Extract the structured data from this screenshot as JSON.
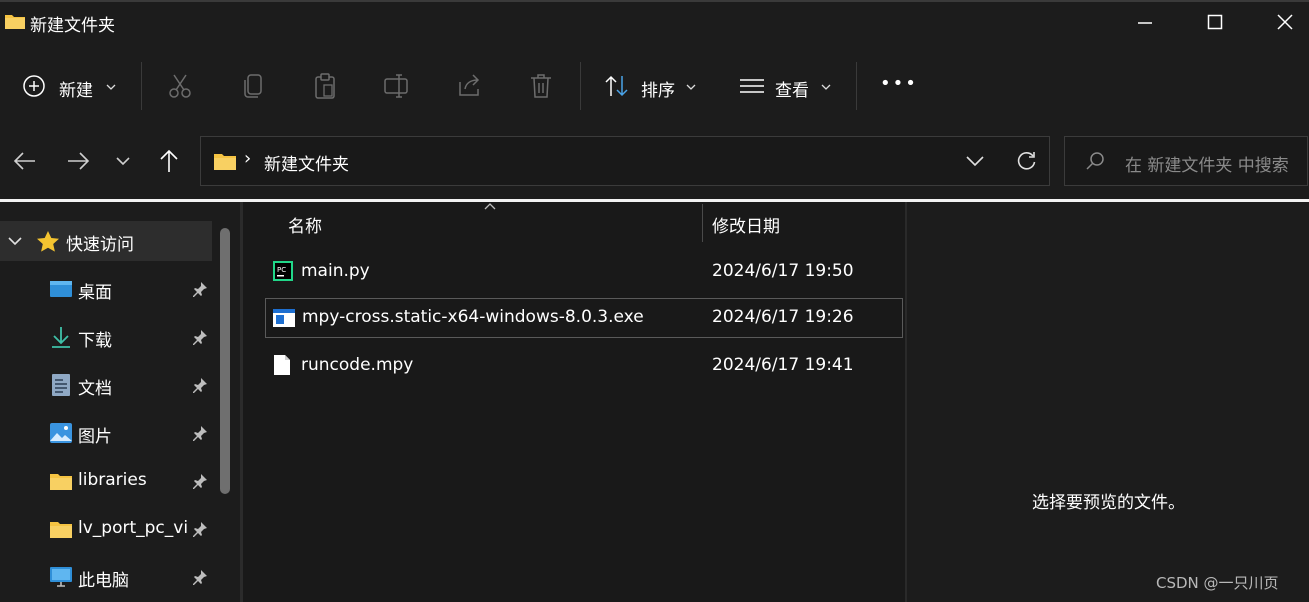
{
  "window": {
    "title": "新建文件夹"
  },
  "toolbar": {
    "new_label": "新建",
    "sort_label": "排序",
    "view_label": "查看",
    "more_label": "•••"
  },
  "address": {
    "separator": "›",
    "path": "新建文件夹",
    "search_placeholder": "在 新建文件夹 中搜索"
  },
  "sidebar": {
    "quick_access": "快速访问",
    "items": [
      {
        "label": "桌面",
        "icon": "desktop-icon"
      },
      {
        "label": "下载",
        "icon": "download-icon"
      },
      {
        "label": "文档",
        "icon": "document-icon"
      },
      {
        "label": "图片",
        "icon": "picture-icon"
      },
      {
        "label": "libraries",
        "icon": "folder-icon"
      },
      {
        "label": "lv_port_pc_vi",
        "icon": "folder-icon"
      },
      {
        "label": "此电脑",
        "icon": "pc-icon"
      }
    ]
  },
  "filelist": {
    "col_name": "名称",
    "col_date": "修改日期",
    "files": [
      {
        "name": "main.py",
        "date": "2024/6/17 19:50",
        "icon": "pycharm-file-icon"
      },
      {
        "name": "mpy-cross.static-x64-windows-8.0.3.exe",
        "date": "2024/6/17 19:26",
        "icon": "exe-file-icon"
      },
      {
        "name": "runcode.mpy",
        "date": "2024/6/17 19:41",
        "icon": "blank-file-icon"
      }
    ]
  },
  "preview": {
    "message": "选择要预览的文件。"
  },
  "watermark": "CSDN @一只川页",
  "colors": {
    "background": "#1c1c1c",
    "folder": "#f5c342",
    "star": "#f4c430",
    "accent_blue": "#4aa3e8"
  }
}
